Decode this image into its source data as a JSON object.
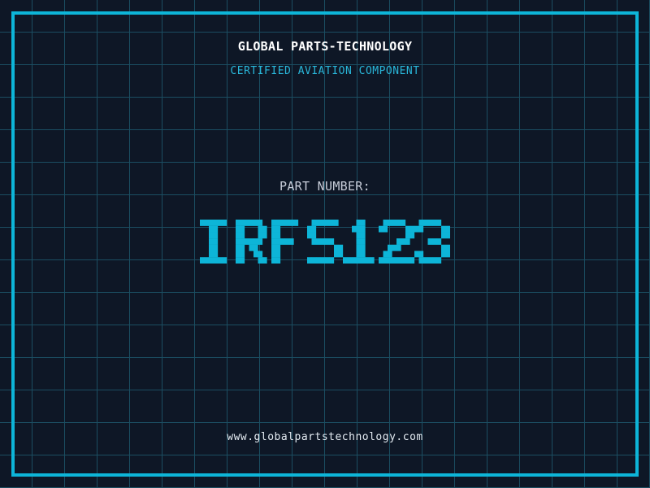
{
  "header": {
    "brand": "GLOBAL PARTS-TECHNOLOGY",
    "tagline": "CERTIFIED AVIATION COMPONENT"
  },
  "part": {
    "label": "PART NUMBER:",
    "value": "IRFS123"
  },
  "footer": {
    "website": "www.globalpartstechnology.com"
  },
  "theme": {
    "background": "#0e1726",
    "grid_line": "#1b4d61",
    "accent_cyan": "#0db5d8",
    "tagline_cyan": "#29b7da",
    "title_white": "#ffffff",
    "label_gray": "#c7cdd9",
    "url_light": "#e4ebf2"
  }
}
